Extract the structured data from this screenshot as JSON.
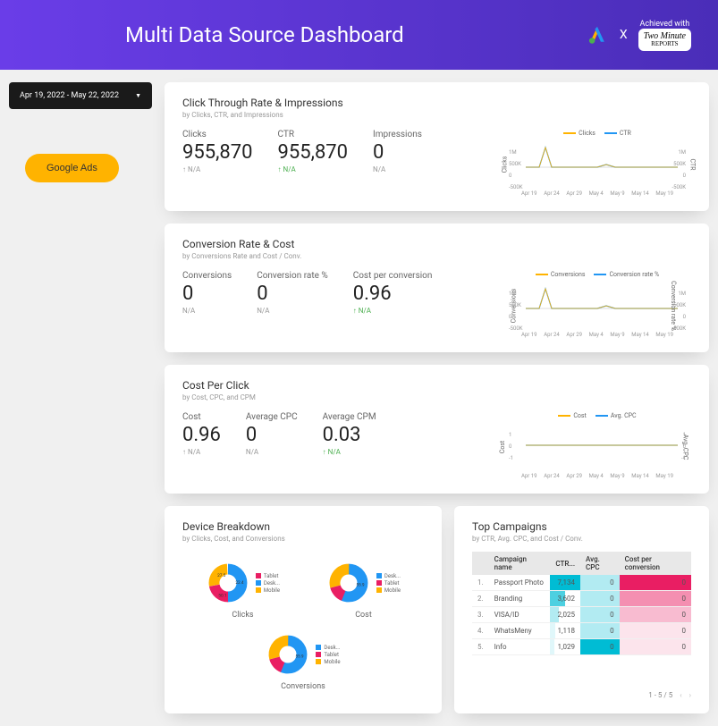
{
  "header": {
    "title": "Multi Data Source Dashboard",
    "x": "X",
    "achieved": "Achieved with",
    "badge_line1": "Two Minute",
    "badge_line2": "REPORTS"
  },
  "sidebar": {
    "date_range": "Apr 19, 2022 - May 22, 2022",
    "google_ads": "Google Ads"
  },
  "card1": {
    "title": "Click Through Rate & Impressions",
    "subtitle": "by Clicks, CTR, and Impressions",
    "metrics": [
      {
        "label": "Clicks",
        "value": "955,870",
        "delta": "N/A"
      },
      {
        "label": "CTR",
        "value": "955,870",
        "delta": "N/A",
        "green": true
      },
      {
        "label": "Impressions",
        "value": "0",
        "delta": "N/A",
        "plain": true
      }
    ],
    "legend": [
      {
        "name": "Clicks",
        "color": "#ffb300"
      },
      {
        "name": "CTR",
        "color": "#2196f3"
      }
    ],
    "axis_left": "Clicks",
    "axis_right": "CTR",
    "y_left": [
      "1M",
      "500K",
      "0",
      "-500K"
    ],
    "y_right": [
      "1M",
      "500K",
      "0",
      "-500K"
    ]
  },
  "card2": {
    "title": "Conversion Rate & Cost",
    "subtitle": "by Conversions Rate and Cost / Conv.",
    "metrics": [
      {
        "label": "Conversions",
        "value": "0",
        "delta": "N/A",
        "plain": true
      },
      {
        "label": "Conversion rate %",
        "value": "0",
        "delta": "N/A",
        "plain": true
      },
      {
        "label": "Cost per conversion",
        "value": "0.96",
        "delta": "N/A",
        "green": true
      }
    ],
    "legend": [
      {
        "name": "Conversions",
        "color": "#ffb300"
      },
      {
        "name": "Conversion rate %",
        "color": "#2196f3"
      }
    ],
    "axis_left": "Conversions",
    "axis_right": "Conversion rate %",
    "y_left": [
      "1M",
      "500K",
      "0",
      "-500K"
    ],
    "y_right": [
      "1M",
      "500K",
      "0",
      "-500K"
    ]
  },
  "card3": {
    "title": "Cost Per Click",
    "subtitle": "by Cost, CPC, and CPM",
    "metrics": [
      {
        "label": "Cost",
        "value": "0.96",
        "delta": "N/A"
      },
      {
        "label": "Average CPC",
        "value": "0",
        "delta": "N/A",
        "plain": true
      },
      {
        "label": "Average CPM",
        "value": "0.03",
        "delta": "N/A",
        "green": true
      }
    ],
    "legend": [
      {
        "name": "Cost",
        "color": "#ffb300"
      },
      {
        "name": "Avg. CPC",
        "color": "#2196f3"
      }
    ],
    "axis_left": "Cost",
    "axis_right": "Avg. CPC",
    "y_left": [
      "1",
      "0",
      "-1"
    ],
    "y_right": [
      "1",
      "0",
      "-1"
    ]
  },
  "x_ticks": [
    "Apr 19",
    "Apr 24",
    "Apr 29",
    "May 4",
    "May 9",
    "May 14",
    "May 19"
  ],
  "device": {
    "title": "Device Breakdown",
    "subtitle": "by Clicks, Cost, and Conversions",
    "captions": {
      "clicks": "Clicks",
      "cost": "Cost",
      "conversions": "Conversions"
    },
    "legend_items": [
      "Tablet",
      "Desk...",
      "Mobile"
    ],
    "legend_items2": [
      "Desk...",
      "Tablet",
      "Mobile"
    ],
    "colors": {
      "tablet": "#e91e63",
      "desktop": "#2196f3",
      "mobile": "#ffb300"
    }
  },
  "campaigns": {
    "title": "Top Campaigns",
    "subtitle": "by CTR, Avg. CPC, and Cost / Conv.",
    "headers": [
      "",
      "Campaign name",
      "CTR...",
      "Avg. CPC",
      "Cost per conversion"
    ],
    "rows": [
      {
        "n": "1.",
        "name": "Passport Photo",
        "ctr": "7,134",
        "ctr_bg": "#00bcd4",
        "ctr_w": 100,
        "cpc": "0",
        "cpc_bg": "#b2ebf2",
        "conv": "0",
        "conv_bg": "#e91e63",
        "conv_w": 100
      },
      {
        "n": "2.",
        "name": "Branding",
        "ctr": "3,602",
        "ctr_bg": "#4dd0e1",
        "ctr_w": 50,
        "cpc": "0",
        "cpc_bg": "#b2ebf2",
        "conv": "0",
        "conv_bg": "#f48fb1",
        "conv_w": 100
      },
      {
        "n": "3.",
        "name": "VISA/ID",
        "ctr": "2,025",
        "ctr_bg": "#b2ebf2",
        "ctr_w": 28,
        "cpc": "0",
        "cpc_bg": "#b2ebf2",
        "conv": "0",
        "conv_bg": "#f8bbd0",
        "conv_w": 100
      },
      {
        "n": "4.",
        "name": "WhatsMeny",
        "ctr": "1,118",
        "ctr_bg": "#e0f7fa",
        "ctr_w": 16,
        "cpc": "0",
        "cpc_bg": "#b2ebf2",
        "conv": "0",
        "conv_bg": "#fce4ec",
        "conv_w": 100
      },
      {
        "n": "5.",
        "name": "Info",
        "ctr": "1,029",
        "ctr_bg": "#e0f7fa",
        "ctr_w": 14,
        "cpc": "0",
        "cpc_bg": "#00bcd4",
        "conv": "0",
        "conv_bg": "#fce4ec",
        "conv_w": 100
      }
    ],
    "pager": "1 - 5 / 5"
  },
  "chart_data": [
    {
      "type": "line",
      "title": "Click Through Rate & Impressions",
      "x": [
        "Apr 19",
        "Apr 24",
        "Apr 29",
        "May 4",
        "May 9",
        "May 14",
        "May 19"
      ],
      "series": [
        {
          "name": "Clicks",
          "values": [
            0,
            800000,
            0,
            0,
            50000,
            0,
            0
          ]
        },
        {
          "name": "CTR",
          "values": [
            0,
            800000,
            0,
            0,
            50000,
            0,
            0
          ]
        }
      ],
      "ylim": [
        -500000,
        1000000
      ]
    },
    {
      "type": "line",
      "title": "Conversion Rate & Cost",
      "x": [
        "Apr 19",
        "Apr 24",
        "Apr 29",
        "May 4",
        "May 9",
        "May 14",
        "May 19"
      ],
      "series": [
        {
          "name": "Conversions",
          "values": [
            0,
            800000,
            0,
            0,
            50000,
            0,
            0
          ]
        },
        {
          "name": "Conversion rate %",
          "values": [
            0,
            800000,
            0,
            0,
            50000,
            0,
            0
          ]
        }
      ],
      "ylim": [
        -500000,
        1000000
      ]
    },
    {
      "type": "line",
      "title": "Cost Per Click",
      "x": [
        "Apr 19",
        "Apr 24",
        "Apr 29",
        "May 4",
        "May 9",
        "May 14",
        "May 19"
      ],
      "series": [
        {
          "name": "Cost",
          "values": [
            0,
            0,
            0,
            0,
            0,
            0,
            0
          ]
        },
        {
          "name": "Avg. CPC",
          "values": [
            0,
            0,
            0,
            0,
            0,
            0,
            0
          ]
        }
      ],
      "ylim": [
        -1,
        1
      ]
    },
    {
      "type": "pie",
      "title": "Device Breakdown - Clicks",
      "categories": [
        "Tablet",
        "Desktop",
        "Mobile"
      ],
      "values": [
        22.4,
        27.5,
        50.1
      ]
    },
    {
      "type": "pie",
      "title": "Device Breakdown - Cost",
      "categories": [
        "Desktop",
        "Tablet",
        "Mobile"
      ],
      "values": [
        55.9,
        15,
        29.1
      ]
    },
    {
      "type": "pie",
      "title": "Device Breakdown - Conversions",
      "categories": [
        "Desktop",
        "Tablet",
        "Mobile"
      ],
      "values": [
        55.9,
        15,
        29.1
      ]
    },
    {
      "type": "table",
      "title": "Top Campaigns",
      "columns": [
        "Campaign name",
        "CTR",
        "Avg. CPC",
        "Cost per conversion"
      ],
      "rows": [
        [
          "Passport Photo",
          7134,
          0,
          0
        ],
        [
          "Branding",
          3602,
          0,
          0
        ],
        [
          "VISA/ID",
          2025,
          0,
          0
        ],
        [
          "WhatsMeny",
          1118,
          0,
          0
        ],
        [
          "Info",
          1029,
          0,
          0
        ]
      ]
    }
  ]
}
